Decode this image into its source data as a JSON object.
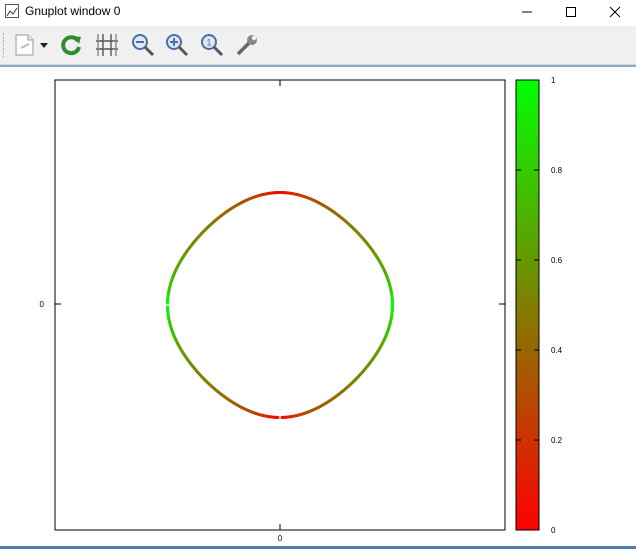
{
  "window": {
    "title": "Gnuplot window 0"
  },
  "toolbar": {
    "buttons": [
      {
        "name": "copy-print-button",
        "icon": "document-icon"
      },
      {
        "name": "dropdown-arrow-button",
        "icon": "triangle-down-icon"
      },
      {
        "name": "replot-button",
        "icon": "refresh-icon"
      },
      {
        "name": "grid-button",
        "icon": "grid-icon"
      },
      {
        "name": "zoom-previous-button",
        "icon": "zoom-out-icon"
      },
      {
        "name": "zoom-next-button",
        "icon": "zoom-in-icon"
      },
      {
        "name": "unzoom-button",
        "icon": "zoom-reset-icon"
      },
      {
        "name": "options-button",
        "icon": "wrench-icon"
      }
    ]
  },
  "chart_data": {
    "type": "contour",
    "xtick_labels": [
      "0"
    ],
    "ytick_labels": [
      "0"
    ],
    "colorbar": {
      "ticks": [
        "0",
        "0.2",
        "0.4",
        "0.6",
        "0.8",
        "1"
      ],
      "range": [
        0,
        1
      ],
      "low_color": "#ff0000",
      "high_color": "#00ff00"
    }
  },
  "colors": {
    "contour_red": "#ff0000",
    "contour_green": "#00ff00",
    "accent": "#4d7cb0"
  }
}
